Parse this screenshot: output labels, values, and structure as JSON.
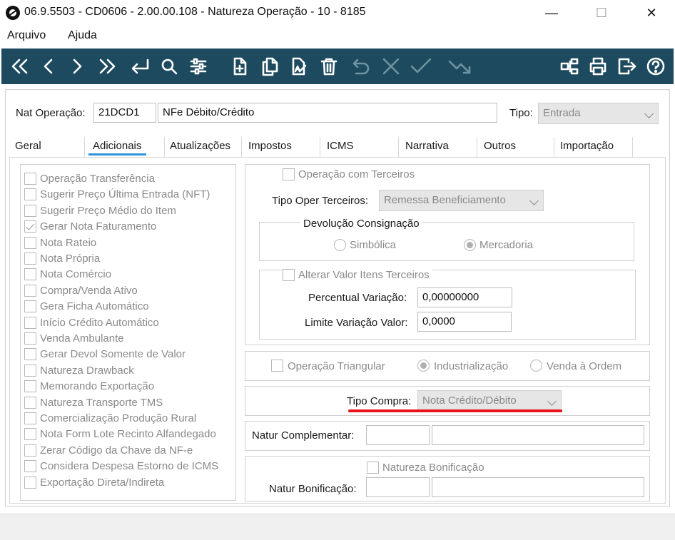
{
  "window": {
    "title": "06.9.5503 - CD0606 - 2.00.00.108 - Natureza Operação - 10 - 8185",
    "controls": {
      "minimize": "—",
      "maximize": "☐",
      "close": "✕"
    }
  },
  "menu": {
    "items": [
      "Arquivo",
      "Ajuda"
    ]
  },
  "toolbar": {
    "buttons": [
      "first-icon",
      "prev-icon",
      "next-icon",
      "last-icon",
      "enter-icon",
      "search-icon",
      "filter-icon",
      "new-doc-icon",
      "copy-doc-icon",
      "edit-doc-icon",
      "trash-icon",
      "undo-icon",
      "cancel-icon",
      "confirm-icon",
      "export-icon",
      "hierarchy-icon",
      "print-icon",
      "exit-icon",
      "help-icon"
    ]
  },
  "header": {
    "nat_label": "Nat Operação:",
    "nat_code": "21DCD1",
    "nat_desc": "NFe Débito/Crédito",
    "tipo_label": "Tipo:",
    "tipo_value": "Entrada"
  },
  "tabs": [
    "Geral",
    "Adicionais",
    "Atualizações",
    "Impostos",
    "ICMS",
    "Narrativa",
    "Outros",
    "Importação"
  ],
  "active_tab": "Adicionais",
  "checklist": [
    {
      "label": "Operação Transferência",
      "checked": false
    },
    {
      "label": "Sugerir Preço Última Entrada (NFT)",
      "checked": false
    },
    {
      "label": "Sugerir Preço Médio do Item",
      "checked": false
    },
    {
      "label": "Gerar Nota Faturamento",
      "checked": true
    },
    {
      "label": "Nota Rateio",
      "checked": false
    },
    {
      "label": "Nota Própria",
      "checked": false
    },
    {
      "label": "Nota Comércio",
      "checked": false
    },
    {
      "label": "Compra/Venda Ativo",
      "checked": false
    },
    {
      "label": "Gera Ficha Automático",
      "checked": false
    },
    {
      "label": "Início Crédito Automático",
      "checked": false
    },
    {
      "label": "Venda Ambulante",
      "checked": false
    },
    {
      "label": "Gerar Devol Somente de Valor",
      "checked": false
    },
    {
      "label": "Natureza Drawback",
      "checked": false
    },
    {
      "label": "Memorando Exportação",
      "checked": false
    },
    {
      "label": "Natureza Transporte TMS",
      "checked": false
    },
    {
      "label": "Comercialização Produção Rural",
      "checked": false
    },
    {
      "label": "Nota Form Lote Recinto Alfandegado",
      "checked": false
    },
    {
      "label": "Zerar Código da Chave da NF-e",
      "checked": false
    },
    {
      "label": "Considera Despesa Estorno de ICMS",
      "checked": false
    },
    {
      "label": "Exportação Direta/Indireta",
      "checked": false
    }
  ],
  "terceiros": {
    "op_terceiros_label": "Operação com Terceiros",
    "tipo_oper_label": "Tipo Oper Terceiros:",
    "tipo_oper_value": "Remessa Beneficiamento",
    "devolucao_legend": "Devolução Consignação",
    "simbolica_label": "Simbólica",
    "mercadoria_label": "Mercadoria",
    "alterar_label": "Alterar Valor Itens Terceiros",
    "percentual_label": "Percentual Variação:",
    "percentual_value": "0,00000000",
    "limite_label": "Limite Variação Valor:",
    "limite_value": "0,0000"
  },
  "triangular": {
    "op_triangular_label": "Operação Triangular",
    "industrializacao_label": "Industrialização",
    "venda_ordem_label": "Venda à Ordem"
  },
  "compra": {
    "tipo_label": "Tipo Compra:",
    "tipo_value": "Nota Crédito/Débito"
  },
  "complementar": {
    "label": "Natur Complementar:",
    "code": "",
    "desc": ""
  },
  "bonificacao": {
    "check_label": "Natureza Bonificação",
    "label": "Natur Bonificação:",
    "code": "",
    "desc": ""
  },
  "colors": {
    "toolbar_bg": "#1d4a5e",
    "tab_active": "#2e93d9",
    "highlight": "#e8141c"
  }
}
